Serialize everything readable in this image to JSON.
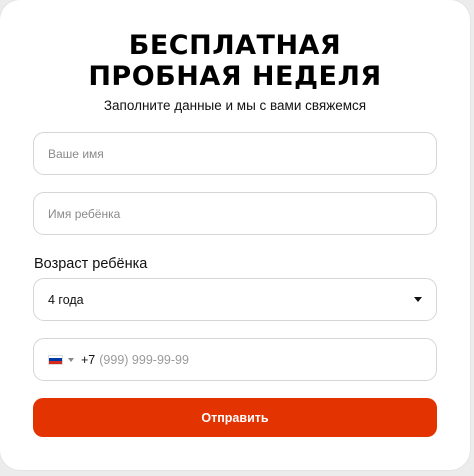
{
  "header": {
    "title_line1": "БЕСПЛАТНАЯ",
    "title_line2": "ПРОБНАЯ НЕДЕЛЯ",
    "subtitle": "Заполните данные и мы с вами свяжемся"
  },
  "form": {
    "name_placeholder": "Ваше имя",
    "child_name_placeholder": "Имя ребёнка",
    "age_label": "Возраст ребёнка",
    "age_value": "4 года",
    "phone_code": "+7",
    "phone_mask": "(999) 999-99-99",
    "phone_country_icon": "russia-flag-icon",
    "submit_label": "Отправить"
  },
  "colors": {
    "accent": "#e23300",
    "flag_white": "#ffffff",
    "flag_blue": "#0039a6",
    "flag_red": "#d52b1e"
  }
}
